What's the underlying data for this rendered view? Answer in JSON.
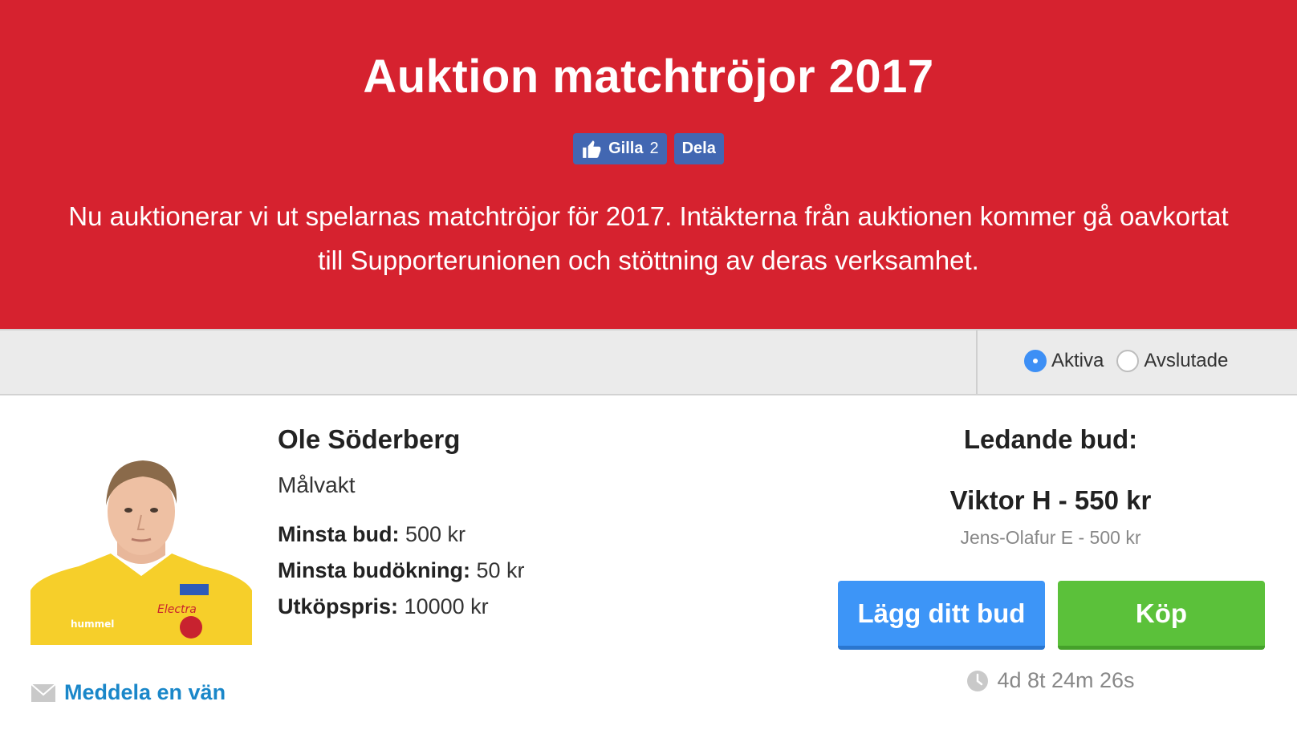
{
  "header": {
    "title": "Auktion matchtröjor 2017",
    "like_label": "Gilla",
    "like_count": "2",
    "share_label": "Dela",
    "description": "Nu auktionerar vi ut spelarnas matchtröjor för 2017. Intäkterna från auktionen kommer gå oavkortat till Supporterunionen och stöttning av deras verksamhet."
  },
  "filter": {
    "options": [
      {
        "label": "Aktiva",
        "checked": true
      },
      {
        "label": "Avslutade",
        "checked": false
      }
    ]
  },
  "item": {
    "player_name": "Ole Söderberg",
    "position": "Målvakt",
    "min_bid_label": "Minsta bud:",
    "min_bid_value": "500 kr",
    "min_increment_label": "Minsta budökning:",
    "min_increment_value": "50 kr",
    "buyout_label": "Utköpspris:",
    "buyout_value": "10000 kr",
    "share_link": "Meddela en vän",
    "leading_label": "Ledande bud:",
    "leading_bid": "Viktor H - 550 kr",
    "previous_bid": "Jens-Olafur E - 500 kr",
    "bid_button": "Lägg ditt bud",
    "buy_button": "Köp",
    "time_left": "4d 8t 24m 26s"
  },
  "colors": {
    "hero_bg": "#d6222f",
    "facebook": "#4267b2",
    "bid_button": "#3d95f7",
    "buy_button": "#5bc13a",
    "link": "#1a87c9"
  },
  "icons": [
    "thumbs-up-icon",
    "mail-icon",
    "clock-icon"
  ]
}
